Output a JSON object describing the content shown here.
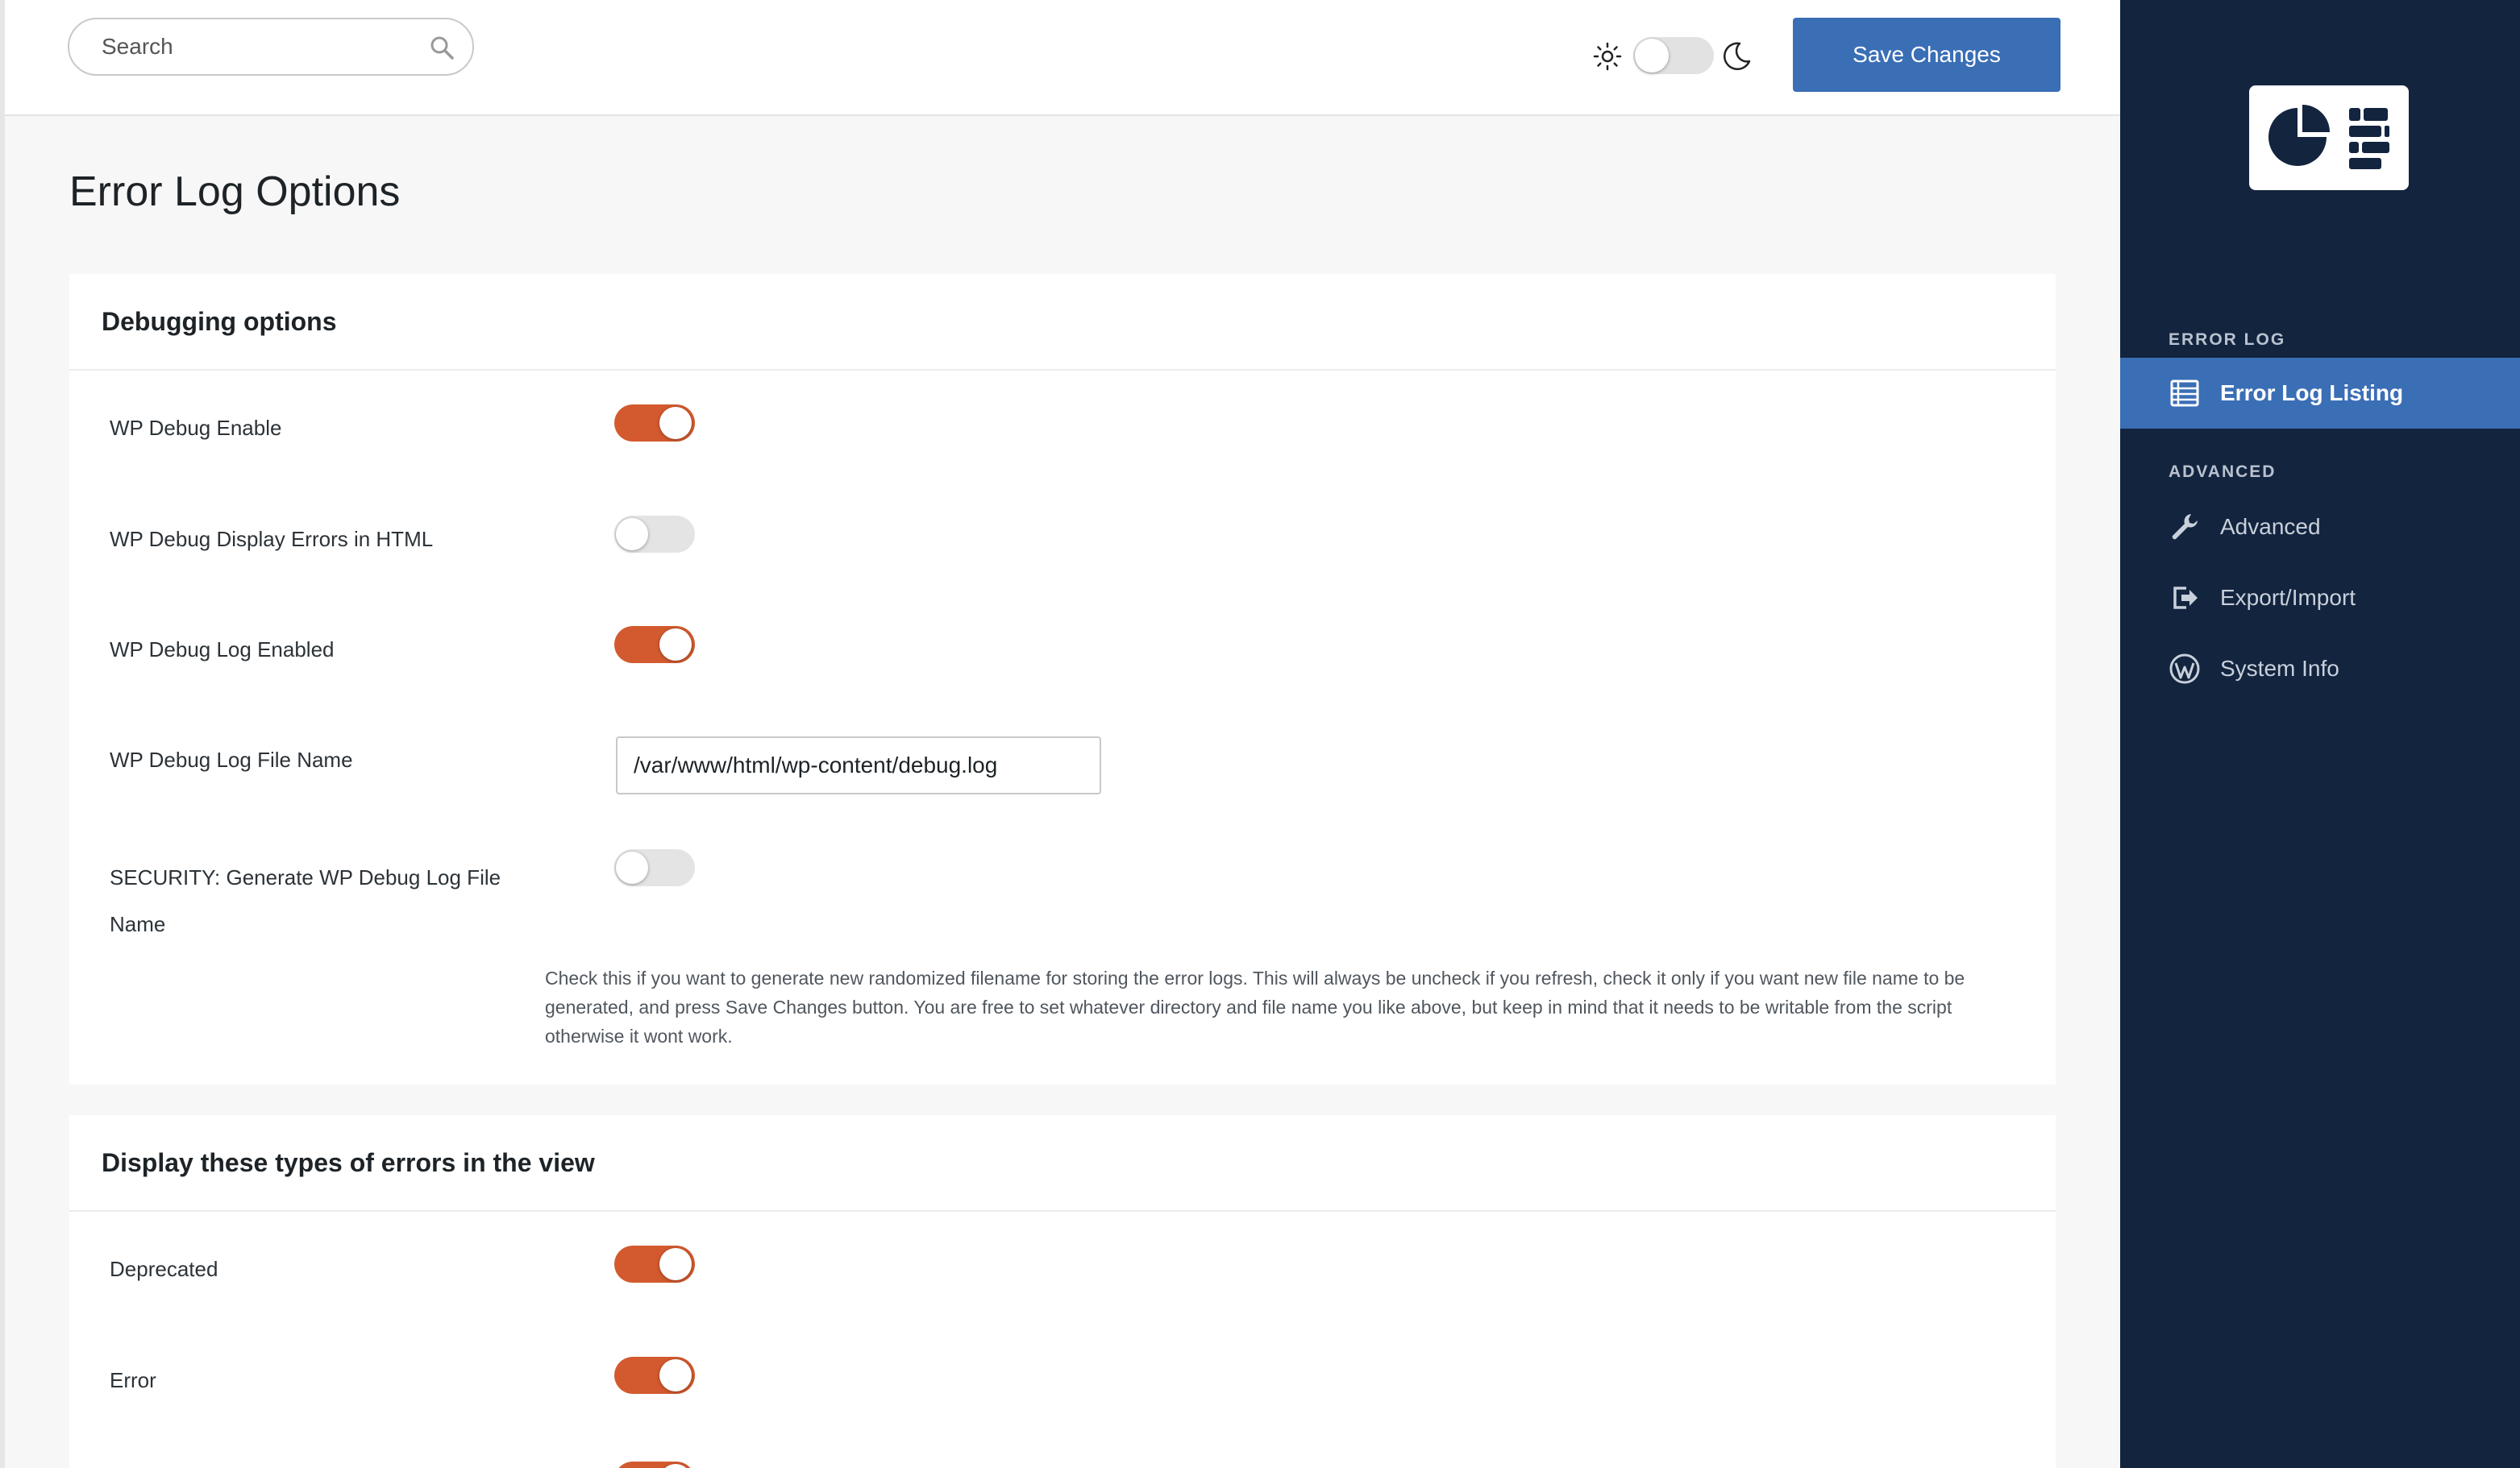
{
  "header": {
    "search_placeholder": "Search",
    "save_label": "Save Changes"
  },
  "page": {
    "title": "Error Log Options"
  },
  "debugging": {
    "heading": "Debugging options",
    "wp_debug_enable_label": "WP Debug Enable",
    "wp_debug_display_label": "WP Debug Display Errors in HTML",
    "wp_debug_log_label": "WP Debug Log Enabled",
    "log_file_name_label": "WP Debug Log File Name",
    "log_file_name_value": "/var/www/html/wp-content/debug.log",
    "security_label": "SECURITY: Generate WP Debug Log File Name",
    "security_help": "Check this if you want to generate new randomized filename for storing the error logs. This will always be uncheck if you refresh, check it only if you want new file name to be generated, and press Save Changes button. You are free to set whatever directory and file name you like above, but keep in mind that it needs to be writable from the script otherwise it wont work."
  },
  "display": {
    "heading": "Display these types of errors in the view",
    "deprecated_label": "Deprecated",
    "error_label": "Error"
  },
  "toggles": {
    "theme_dark": false,
    "wp_debug_enable": true,
    "wp_debug_display": false,
    "wp_debug_log": true,
    "security_generate": false,
    "deprecated": true,
    "error": true,
    "next_partial": true
  },
  "sidebar": {
    "section_error_log": "ERROR LOG",
    "section_advanced": "ADVANCED",
    "items": [
      {
        "label": "Error Log Listing",
        "icon": "list-icon"
      },
      {
        "label": "Advanced",
        "icon": "wrench-icon"
      },
      {
        "label": "Export/Import",
        "icon": "export-icon"
      },
      {
        "label": "System Info",
        "icon": "wordpress-icon"
      }
    ]
  },
  "colors": {
    "accent": "#3a6eb5",
    "toggle_on": "#d35a2e",
    "sidebar_bg": "#13243f"
  }
}
